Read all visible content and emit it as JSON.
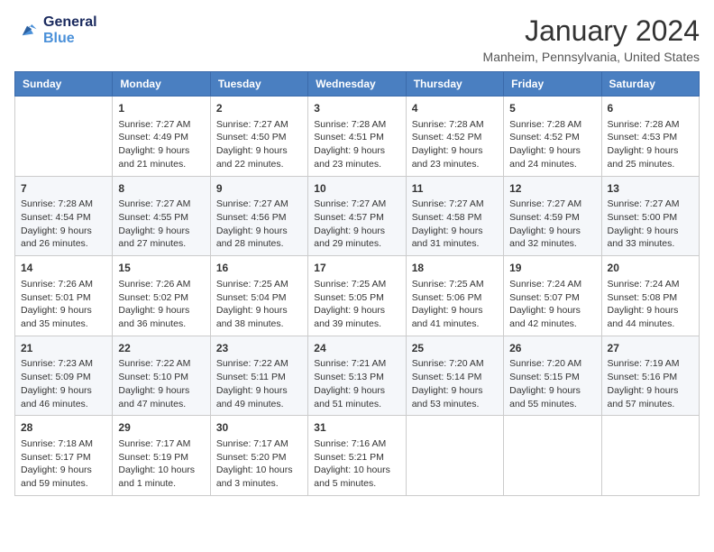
{
  "header": {
    "logo_line1": "General",
    "logo_line2": "Blue",
    "month": "January 2024",
    "location": "Manheim, Pennsylvania, United States"
  },
  "days_of_week": [
    "Sunday",
    "Monday",
    "Tuesday",
    "Wednesday",
    "Thursday",
    "Friday",
    "Saturday"
  ],
  "weeks": [
    [
      {
        "day": "",
        "sunrise": "",
        "sunset": "",
        "daylight": ""
      },
      {
        "day": "1",
        "sunrise": "Sunrise: 7:27 AM",
        "sunset": "Sunset: 4:49 PM",
        "daylight": "Daylight: 9 hours and 21 minutes."
      },
      {
        "day": "2",
        "sunrise": "Sunrise: 7:27 AM",
        "sunset": "Sunset: 4:50 PM",
        "daylight": "Daylight: 9 hours and 22 minutes."
      },
      {
        "day": "3",
        "sunrise": "Sunrise: 7:28 AM",
        "sunset": "Sunset: 4:51 PM",
        "daylight": "Daylight: 9 hours and 23 minutes."
      },
      {
        "day": "4",
        "sunrise": "Sunrise: 7:28 AM",
        "sunset": "Sunset: 4:52 PM",
        "daylight": "Daylight: 9 hours and 23 minutes."
      },
      {
        "day": "5",
        "sunrise": "Sunrise: 7:28 AM",
        "sunset": "Sunset: 4:52 PM",
        "daylight": "Daylight: 9 hours and 24 minutes."
      },
      {
        "day": "6",
        "sunrise": "Sunrise: 7:28 AM",
        "sunset": "Sunset: 4:53 PM",
        "daylight": "Daylight: 9 hours and 25 minutes."
      }
    ],
    [
      {
        "day": "7",
        "sunrise": "Sunrise: 7:28 AM",
        "sunset": "Sunset: 4:54 PM",
        "daylight": "Daylight: 9 hours and 26 minutes."
      },
      {
        "day": "8",
        "sunrise": "Sunrise: 7:27 AM",
        "sunset": "Sunset: 4:55 PM",
        "daylight": "Daylight: 9 hours and 27 minutes."
      },
      {
        "day": "9",
        "sunrise": "Sunrise: 7:27 AM",
        "sunset": "Sunset: 4:56 PM",
        "daylight": "Daylight: 9 hours and 28 minutes."
      },
      {
        "day": "10",
        "sunrise": "Sunrise: 7:27 AM",
        "sunset": "Sunset: 4:57 PM",
        "daylight": "Daylight: 9 hours and 29 minutes."
      },
      {
        "day": "11",
        "sunrise": "Sunrise: 7:27 AM",
        "sunset": "Sunset: 4:58 PM",
        "daylight": "Daylight: 9 hours and 31 minutes."
      },
      {
        "day": "12",
        "sunrise": "Sunrise: 7:27 AM",
        "sunset": "Sunset: 4:59 PM",
        "daylight": "Daylight: 9 hours and 32 minutes."
      },
      {
        "day": "13",
        "sunrise": "Sunrise: 7:27 AM",
        "sunset": "Sunset: 5:00 PM",
        "daylight": "Daylight: 9 hours and 33 minutes."
      }
    ],
    [
      {
        "day": "14",
        "sunrise": "Sunrise: 7:26 AM",
        "sunset": "Sunset: 5:01 PM",
        "daylight": "Daylight: 9 hours and 35 minutes."
      },
      {
        "day": "15",
        "sunrise": "Sunrise: 7:26 AM",
        "sunset": "Sunset: 5:02 PM",
        "daylight": "Daylight: 9 hours and 36 minutes."
      },
      {
        "day": "16",
        "sunrise": "Sunrise: 7:25 AM",
        "sunset": "Sunset: 5:04 PM",
        "daylight": "Daylight: 9 hours and 38 minutes."
      },
      {
        "day": "17",
        "sunrise": "Sunrise: 7:25 AM",
        "sunset": "Sunset: 5:05 PM",
        "daylight": "Daylight: 9 hours and 39 minutes."
      },
      {
        "day": "18",
        "sunrise": "Sunrise: 7:25 AM",
        "sunset": "Sunset: 5:06 PM",
        "daylight": "Daylight: 9 hours and 41 minutes."
      },
      {
        "day": "19",
        "sunrise": "Sunrise: 7:24 AM",
        "sunset": "Sunset: 5:07 PM",
        "daylight": "Daylight: 9 hours and 42 minutes."
      },
      {
        "day": "20",
        "sunrise": "Sunrise: 7:24 AM",
        "sunset": "Sunset: 5:08 PM",
        "daylight": "Daylight: 9 hours and 44 minutes."
      }
    ],
    [
      {
        "day": "21",
        "sunrise": "Sunrise: 7:23 AM",
        "sunset": "Sunset: 5:09 PM",
        "daylight": "Daylight: 9 hours and 46 minutes."
      },
      {
        "day": "22",
        "sunrise": "Sunrise: 7:22 AM",
        "sunset": "Sunset: 5:10 PM",
        "daylight": "Daylight: 9 hours and 47 minutes."
      },
      {
        "day": "23",
        "sunrise": "Sunrise: 7:22 AM",
        "sunset": "Sunset: 5:11 PM",
        "daylight": "Daylight: 9 hours and 49 minutes."
      },
      {
        "day": "24",
        "sunrise": "Sunrise: 7:21 AM",
        "sunset": "Sunset: 5:13 PM",
        "daylight": "Daylight: 9 hours and 51 minutes."
      },
      {
        "day": "25",
        "sunrise": "Sunrise: 7:20 AM",
        "sunset": "Sunset: 5:14 PM",
        "daylight": "Daylight: 9 hours and 53 minutes."
      },
      {
        "day": "26",
        "sunrise": "Sunrise: 7:20 AM",
        "sunset": "Sunset: 5:15 PM",
        "daylight": "Daylight: 9 hours and 55 minutes."
      },
      {
        "day": "27",
        "sunrise": "Sunrise: 7:19 AM",
        "sunset": "Sunset: 5:16 PM",
        "daylight": "Daylight: 9 hours and 57 minutes."
      }
    ],
    [
      {
        "day": "28",
        "sunrise": "Sunrise: 7:18 AM",
        "sunset": "Sunset: 5:17 PM",
        "daylight": "Daylight: 9 hours and 59 minutes."
      },
      {
        "day": "29",
        "sunrise": "Sunrise: 7:17 AM",
        "sunset": "Sunset: 5:19 PM",
        "daylight": "Daylight: 10 hours and 1 minute."
      },
      {
        "day": "30",
        "sunrise": "Sunrise: 7:17 AM",
        "sunset": "Sunset: 5:20 PM",
        "daylight": "Daylight: 10 hours and 3 minutes."
      },
      {
        "day": "31",
        "sunrise": "Sunrise: 7:16 AM",
        "sunset": "Sunset: 5:21 PM",
        "daylight": "Daylight: 10 hours and 5 minutes."
      },
      {
        "day": "",
        "sunrise": "",
        "sunset": "",
        "daylight": ""
      },
      {
        "day": "",
        "sunrise": "",
        "sunset": "",
        "daylight": ""
      },
      {
        "day": "",
        "sunrise": "",
        "sunset": "",
        "daylight": ""
      }
    ]
  ]
}
